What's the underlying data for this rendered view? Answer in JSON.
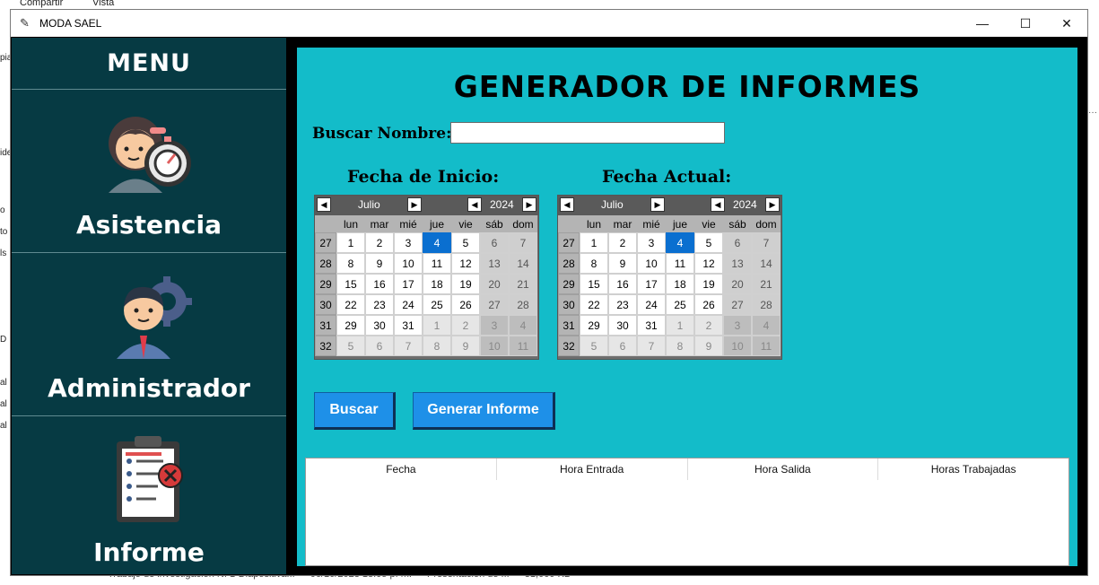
{
  "background": {
    "menu": [
      "Compartir",
      "Vista"
    ],
    "side_fragments": [
      "pia",
      "ide",
      "o",
      "to",
      "ls",
      "D",
      "al (",
      "al (",
      "al ("
    ],
    "bottom_row": [
      "Trabajo de investigación N. 1-Diapositiva...",
      "06/10/2023 18:05 p. m.",
      "Presentación de ...",
      "31,000 KB"
    ]
  },
  "window": {
    "title": "MODA SAEL",
    "minimize": "—",
    "maximize": "☐",
    "close": "✕"
  },
  "sidebar": {
    "header": "MENU",
    "items": [
      {
        "label": "Asistencia",
        "icon": "attendance-clock-icon"
      },
      {
        "label": "Administrador",
        "icon": "admin-gear-icon"
      },
      {
        "label": "Informe",
        "icon": "report-clipboard-icon"
      }
    ]
  },
  "main": {
    "title": "GENERADOR DE INFORMES",
    "search_label": "Buscar Nombre:",
    "search_value": "",
    "start_label": "Fecha de Inicio:",
    "current_label": "Fecha Actual:",
    "buttons": {
      "search": "Buscar",
      "generate": "Generar Informe"
    },
    "table_headers": [
      "Fecha",
      "Hora Entrada",
      "Hora Salida",
      "Horas Trabajadas"
    ]
  },
  "calendar": {
    "month": "Julio",
    "year": "2024",
    "day_names": [
      "lun",
      "mar",
      "mié",
      "jue",
      "vie",
      "sáb",
      "dom"
    ],
    "weeks": [
      {
        "wk": "27",
        "days": [
          "1",
          "2",
          "3",
          "4",
          "5",
          "6",
          "7"
        ]
      },
      {
        "wk": "28",
        "days": [
          "8",
          "9",
          "10",
          "11",
          "12",
          "13",
          "14"
        ]
      },
      {
        "wk": "29",
        "days": [
          "15",
          "16",
          "17",
          "18",
          "19",
          "20",
          "21"
        ]
      },
      {
        "wk": "30",
        "days": [
          "22",
          "23",
          "24",
          "25",
          "26",
          "27",
          "28"
        ]
      },
      {
        "wk": "31",
        "days": [
          "29",
          "30",
          "31",
          "1",
          "2",
          "3",
          "4"
        ]
      },
      {
        "wk": "32",
        "days": [
          "5",
          "6",
          "7",
          "8",
          "9",
          "10",
          "11"
        ]
      }
    ],
    "selected_day": "4",
    "accent": "#0a6fd0"
  },
  "colors": {
    "sidebar": "#063a43",
    "panel": "#13bcc9",
    "button": "#1e90e8"
  }
}
